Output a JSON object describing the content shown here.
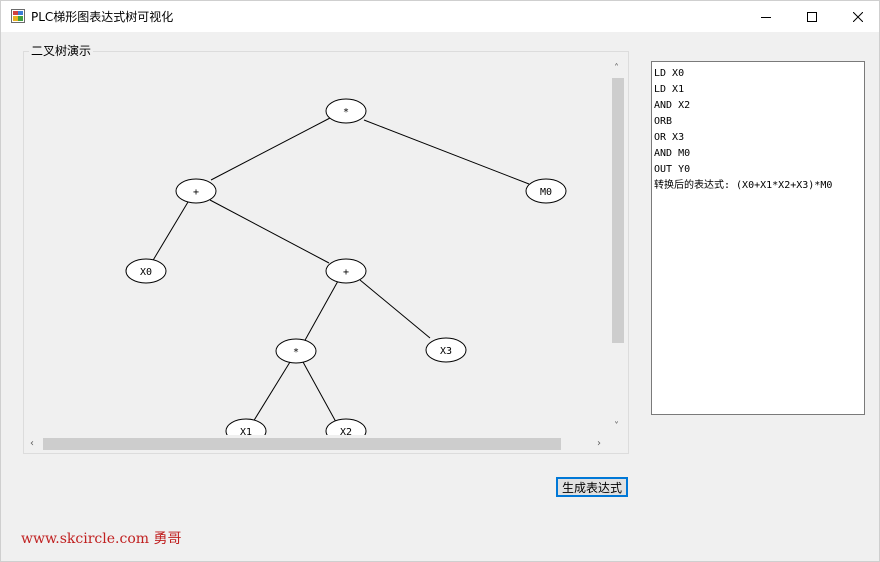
{
  "window": {
    "title": "PLC梯形图表达式树可视化"
  },
  "groupbox": {
    "label": "二叉树演示"
  },
  "tree": {
    "nodes": {
      "root": "*",
      "plus1": "+",
      "m0": "M0",
      "x0": "X0",
      "plus2": "+",
      "mul2": "*",
      "x3": "X3",
      "x1": "X1",
      "x2": "X2"
    }
  },
  "output": {
    "lines": [
      "LD X0",
      "LD X1",
      "AND X2",
      "ORB",
      "OR X3",
      "AND M0",
      "OUT Y0",
      "转换后的表达式: (X0+X1*X2+X3)*M0"
    ]
  },
  "button": {
    "label": "生成表达式"
  },
  "watermark": {
    "text": "www.skcircle.com 勇哥"
  },
  "colors": {
    "accent": "#0078d7",
    "watermark": "#c02020"
  }
}
